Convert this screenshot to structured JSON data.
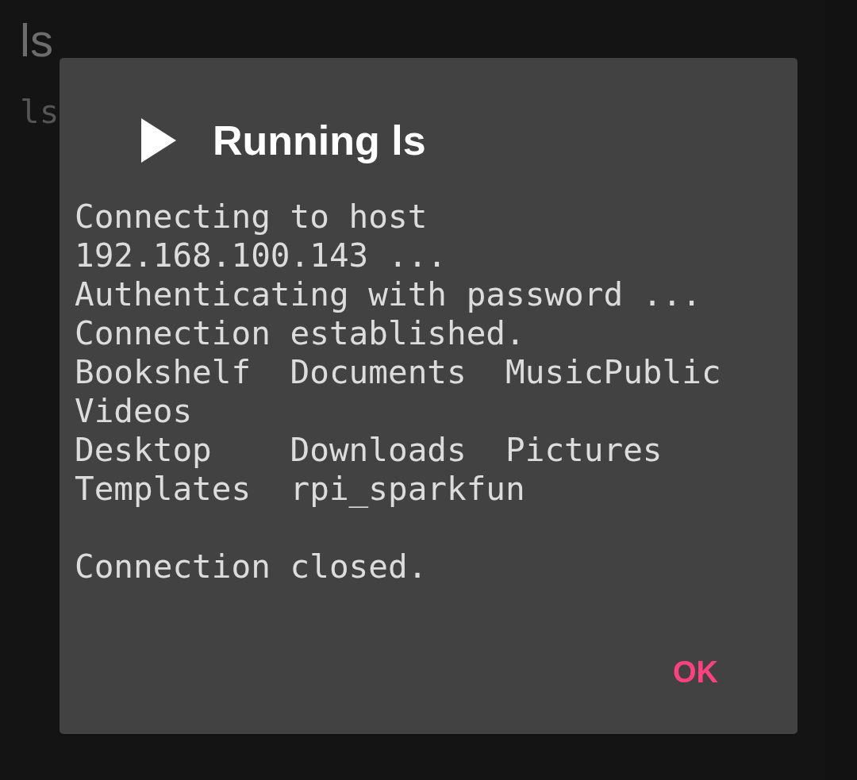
{
  "screen": {
    "title": "ls",
    "command": "ls"
  },
  "dialog": {
    "title": "Running ls",
    "output": "Connecting to host\n192.168.100.143 ...\nAuthenticating with password ...\nConnection established.\nBookshelf  Documents  MusicPublic\nVideos\nDesktop    Downloads  Pictures\nTemplates  rpi_sparkfun\n\nConnection closed.",
    "buttons": [
      "OK"
    ]
  }
}
